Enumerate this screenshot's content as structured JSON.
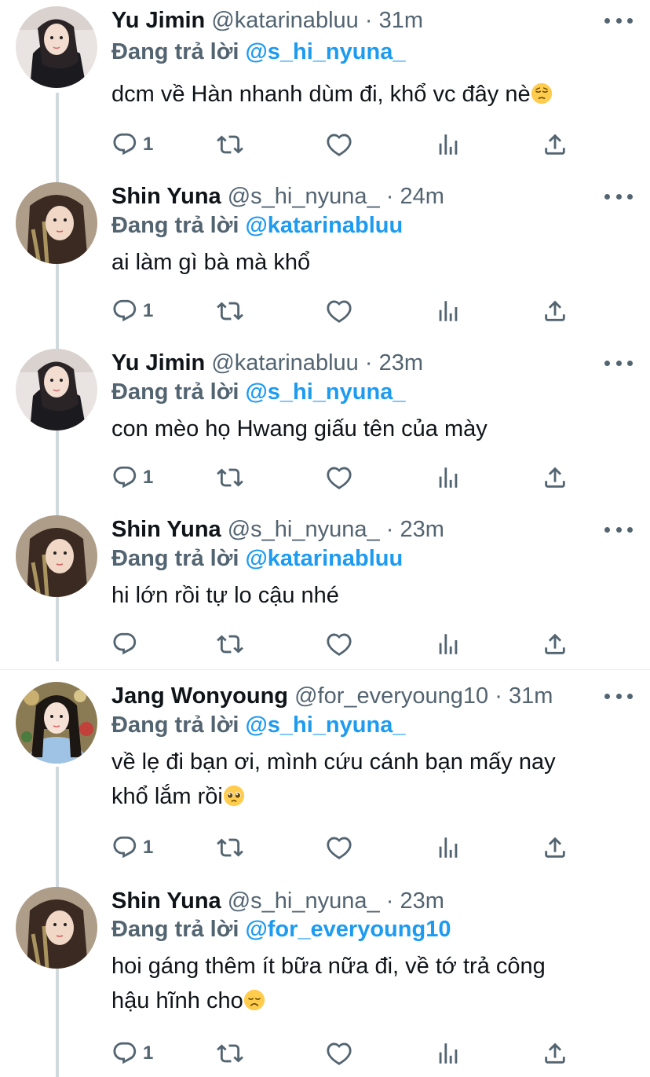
{
  "reply_prefix": "Đang trả lời",
  "dot": "·",
  "tweets": [
    {
      "name": "Yu Jimin",
      "handle": "@katarinabluu",
      "time": "31m",
      "reply_to": "@s_hi_nyuna_",
      "text": "dcm về Hàn nhanh dùm đi, khổ vc đây nè",
      "emoji": "pensive-face",
      "reply_count": "1"
    },
    {
      "name": "Shin Yuna",
      "handle": "@s_hi_nyuna_",
      "time": "24m",
      "reply_to": "@katarinabluu",
      "text": "ai làm gì bà mà khổ",
      "emoji": "",
      "reply_count": "1"
    },
    {
      "name": "Yu Jimin",
      "handle": "@katarinabluu",
      "time": "23m",
      "reply_to": "@s_hi_nyuna_",
      "text": "con mèo họ Hwang giấu tên của mày",
      "emoji": "",
      "reply_count": "1"
    },
    {
      "name": "Shin Yuna",
      "handle": "@s_hi_nyuna_",
      "time": "23m",
      "reply_to": "@katarinabluu",
      "text": "hi lớn rồi tự lo cậu nhé",
      "emoji": "",
      "reply_count": ""
    },
    {
      "name": "Jang Wonyoung",
      "handle": "@for_everyoung10",
      "time": "31m",
      "reply_to": "@s_hi_nyuna_",
      "text_line1": "về lẹ đi bạn ơi, mình cứu cánh bạn mấy nay",
      "text_line2": "khổ lắm rồi",
      "emoji": "pleading-face",
      "reply_count": "1"
    },
    {
      "name": "Shin Yuna",
      "handle": "@s_hi_nyuna_",
      "time": "23m",
      "reply_to": "@for_everyoung10",
      "text_line1": "hoi gáng thêm ít bữa nữa đi, về tớ trả công",
      "text_line2": "hậu hĩnh cho",
      "emoji": "disappointed-face",
      "reply_count": "1"
    }
  ],
  "colors": {
    "link": "#1d9bf0",
    "secondary_text": "#536471",
    "thread_line": "#cfd9de",
    "divider": "#e6ecf0"
  }
}
